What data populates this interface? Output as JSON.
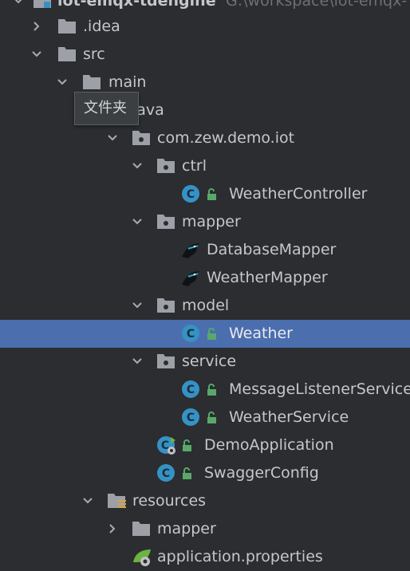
{
  "project": {
    "name": "iot-emqx-tdengine",
    "path": "G:\\workspace\\iot-emqx-"
  },
  "tooltip": "文件夹",
  "tree": [
    {
      "label": ".idea",
      "kind": "folder",
      "expanded": false
    },
    {
      "label": "src",
      "kind": "folder",
      "expanded": true
    },
    {
      "label": "main",
      "kind": "folder",
      "expanded": true
    },
    {
      "label": "java",
      "kind": "source-folder",
      "expanded": true
    },
    {
      "label": "com.zew.demo.iot",
      "kind": "package",
      "expanded": true
    },
    {
      "label": "ctrl",
      "kind": "package",
      "expanded": true
    },
    {
      "label": "WeatherController",
      "kind": "class"
    },
    {
      "label": "mapper",
      "kind": "package",
      "expanded": true
    },
    {
      "label": "DatabaseMapper",
      "kind": "mybatis-mapper"
    },
    {
      "label": "WeatherMapper",
      "kind": "mybatis-mapper"
    },
    {
      "label": "model",
      "kind": "package",
      "expanded": true
    },
    {
      "label": "Weather",
      "kind": "class",
      "selected": true
    },
    {
      "label": "service",
      "kind": "package",
      "expanded": true
    },
    {
      "label": "MessageListenerService",
      "kind": "class"
    },
    {
      "label": "WeatherService",
      "kind": "class"
    },
    {
      "label": "DemoApplication",
      "kind": "spring-boot-class"
    },
    {
      "label": "SwaggerConfig",
      "kind": "class"
    },
    {
      "label": "resources",
      "kind": "resources-folder",
      "expanded": true
    },
    {
      "label": "mapper",
      "kind": "folder",
      "expanded": false
    },
    {
      "label": "application.properties",
      "kind": "spring-properties"
    }
  ],
  "colors": {
    "background": "#2b2d30",
    "selection": "#4b6eaf",
    "folder": "#9da0a6",
    "class_circle": "#3592c4",
    "lock": "#59a869",
    "spring": "#6db33f"
  }
}
